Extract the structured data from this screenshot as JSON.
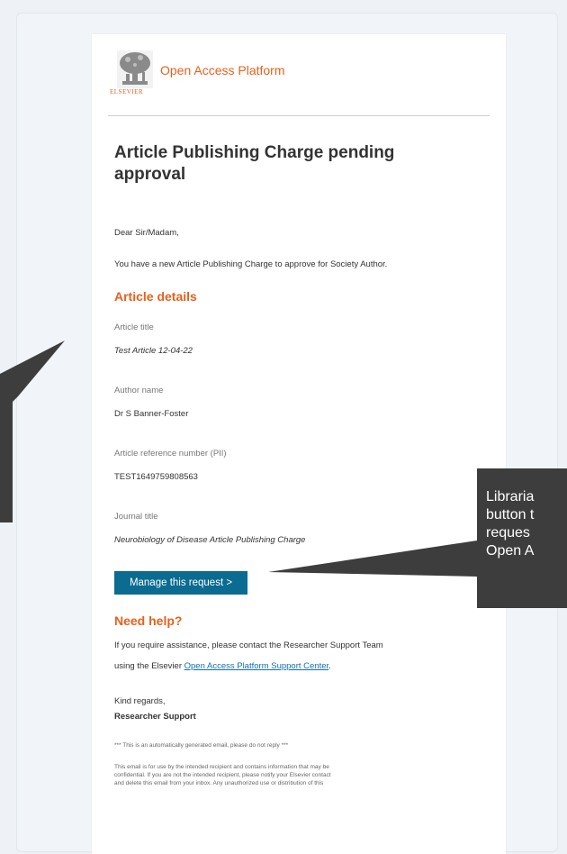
{
  "header": {
    "logo_text": "ELSEVIER",
    "platform_title": "Open Access Platform"
  },
  "email": {
    "heading": "Article Publishing Charge pending approval",
    "greeting": "Dear Sir/Madam,",
    "intro": "You have a new Article Publishing Charge to approve for Society Author.",
    "article_details_heading": "Article details",
    "article_title_label": "Article title",
    "article_title_value": "Test Article 12-04-22",
    "author_name_label": "Author name",
    "author_name_value": "Dr S Banner-Foster",
    "reference_label": "Article reference number (PII)",
    "reference_value": "TEST1649759808563",
    "journal_label": "Journal title",
    "journal_value": "Neurobiology of Disease Article Publishing Charge",
    "manage_button": "Manage this request >",
    "need_help_heading": "Need help?",
    "help_text_1": "If you require assistance, please contact the Researcher Support Team",
    "help_text_2": "using the Elsevier ",
    "help_link": "Open Access Platform Support Center",
    "help_text_3": ".",
    "regards": "Kind regards,",
    "signature": "Researcher Support",
    "auto_notice": "*** This is an automatically generated email, please do not reply ***",
    "disclaimer_1": "This email is for use by the intended recipient and contains information that may be",
    "disclaimer_2": "confidential. If you are not the intended recipient, please notify your Elsevier contact",
    "disclaimer_3": "and delete this email from your inbox. Any unauthorized use or distribution of this"
  },
  "callout": {
    "line1": "Libraria",
    "line2": "button t",
    "line3": "reques",
    "line4": "Open A"
  },
  "colors": {
    "accent": "#e8601c",
    "button": "#0b6b91",
    "link": "#0f6fb5",
    "callout": "#3d3d3d"
  }
}
